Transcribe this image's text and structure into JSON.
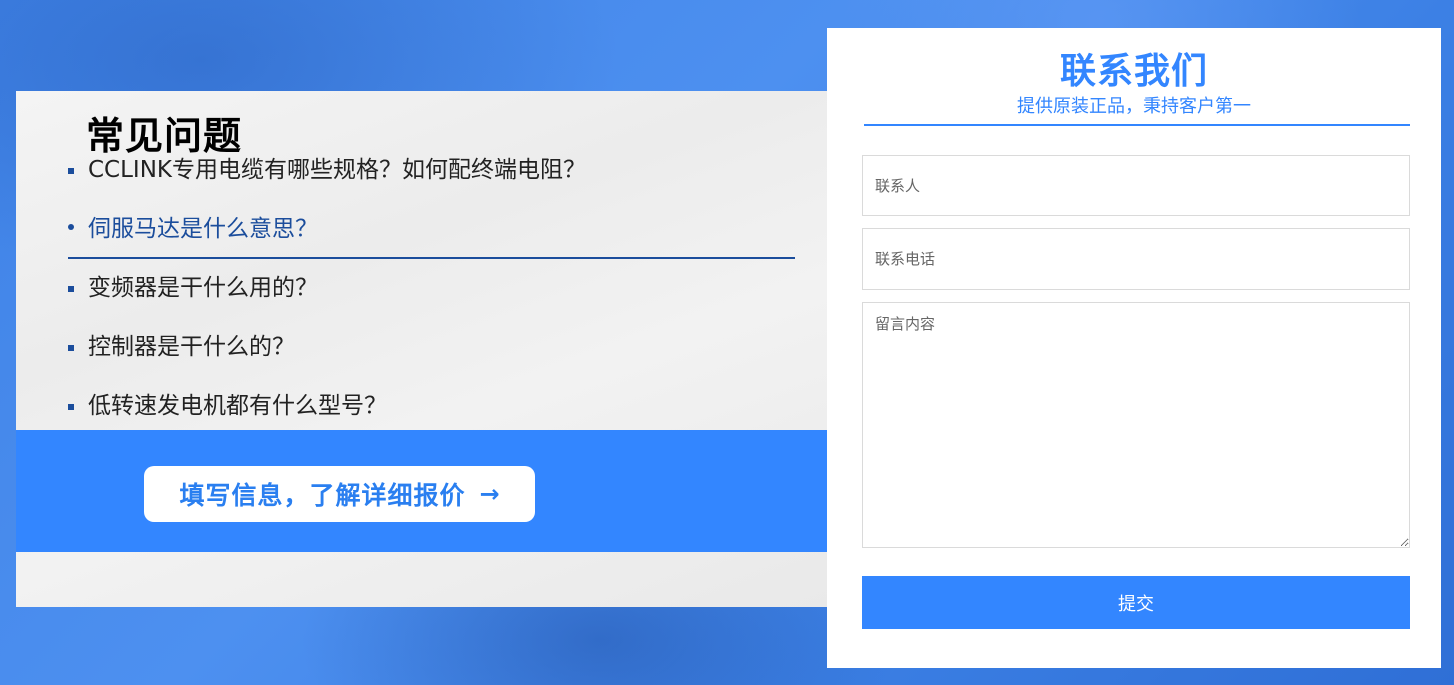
{
  "faq": {
    "title": "常见问题",
    "items": [
      {
        "text": "CCLINK专用电缆有哪些规格？如何配终端电阻？"
      },
      {
        "text": "伺服马达是什么意思？"
      },
      {
        "text": "变频器是干什么用的？"
      },
      {
        "text": "控制器是干什么的？"
      },
      {
        "text": "低转速发电机都有什么型号？"
      }
    ],
    "active_index": 1,
    "cta_label": "填写信息，了解详细报价",
    "cta_arrow": "→"
  },
  "contact": {
    "title": "联系我们",
    "subtitle": "提供原装正品，秉持客户第一",
    "name_placeholder": "联系人",
    "phone_placeholder": "联系电话",
    "message_placeholder": "留言内容",
    "submit_label": "提交"
  },
  "colors": {
    "accent": "#3386ff",
    "faq_active": "#1b4d9c"
  }
}
